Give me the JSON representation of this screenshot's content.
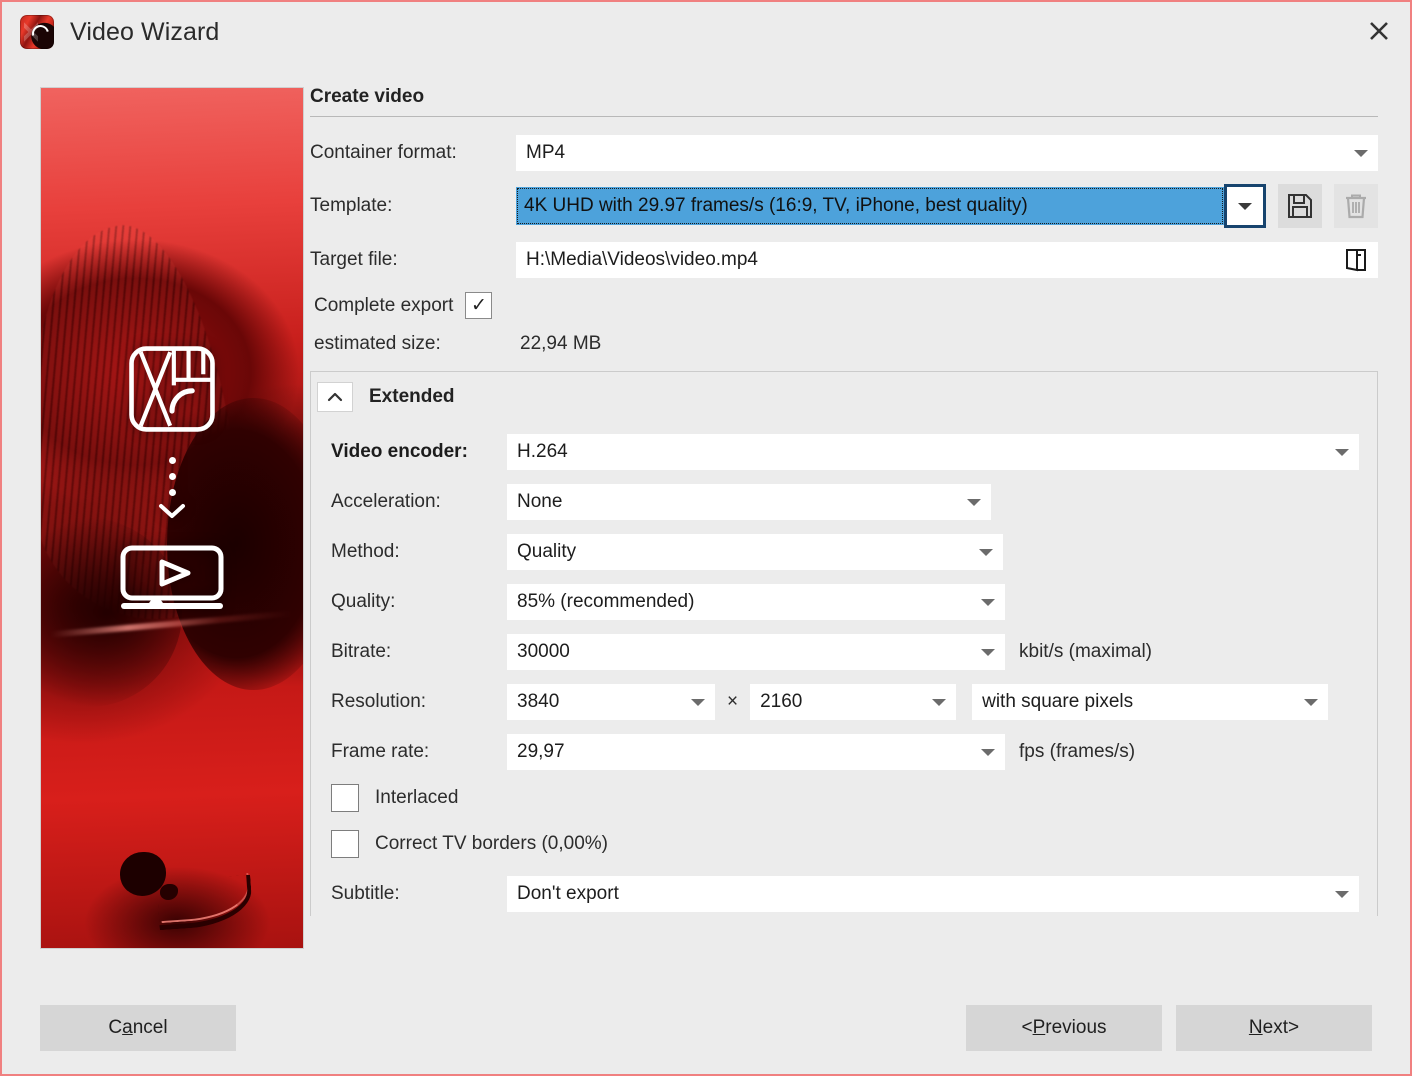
{
  "window": {
    "title": "Video Wizard",
    "app_icon": "video-wizard-app-icon",
    "close_icon": "close-icon",
    "border_color": "#f08080"
  },
  "preview": {
    "name": "video-preview-thumbnail",
    "logo_icon": "video-wizard-logo-icon",
    "dots_icon": "vertical-dots-icon",
    "chevron_icon": "chevron-down-icon",
    "player_icon": "video-player-icon"
  },
  "main": {
    "heading": "Create video",
    "fields": {
      "container_format": {
        "label": "Container format:",
        "value": "MP4"
      },
      "template": {
        "label": "Template:",
        "value": "4K UHD with 29.97 frames/s (16:9, TV, iPhone, best quality)",
        "selected": true,
        "highlight_color": "#4da2db",
        "focus_border_color": "#17446e",
        "save_icon": "save-floppy-icon",
        "delete_icon": "delete-trash-icon"
      },
      "target_file": {
        "label": "Target file:",
        "value": "H:\\Media\\Videos\\video.mp4",
        "browse_icon": "open-folder-icon"
      },
      "complete_export": {
        "label": "Complete export",
        "checked": true,
        "check_glyph": "✓"
      },
      "estimated_size": {
        "label": "estimated size:",
        "value": "22,94 MB"
      }
    }
  },
  "extended": {
    "title": "Extended",
    "collapse_icon": "chevron-up-icon",
    "expanded": true,
    "rows": {
      "video_encoder": {
        "label": "Video encoder:",
        "value": "H.264"
      },
      "acceleration": {
        "label": "Acceleration:",
        "value": "None"
      },
      "method": {
        "label": "Method:",
        "value": "Quality"
      },
      "quality": {
        "label": "Quality:",
        "value": "85% (recommended)"
      },
      "bitrate": {
        "label": "Bitrate:",
        "value": "30000",
        "unit": "kbit/s (maximal)"
      },
      "resolution": {
        "label": "Resolution:",
        "width": "3840",
        "separator": "×",
        "height": "2160",
        "pixel_mode": "with square pixels"
      },
      "frame_rate": {
        "label": "Frame rate:",
        "value": "29,97",
        "unit": "fps (frames/s)"
      },
      "interlaced": {
        "label": "Interlaced",
        "checked": false
      },
      "correct_tv_borders": {
        "label": "Correct TV borders (0,00%)",
        "checked": false
      },
      "subtitle": {
        "label": "Subtitle:",
        "value": "Don't export"
      }
    }
  },
  "footer": {
    "cancel": {
      "pre": "C",
      "mnemonic": "a",
      "post": "ncel",
      "label": "Cancel"
    },
    "previous": {
      "prefix": "< ",
      "pre": "",
      "mnemonic": "P",
      "post": "revious",
      "label": "< Previous"
    },
    "next": {
      "pre": "",
      "mnemonic": "N",
      "post": "ext",
      "suffix": " >",
      "label": "Next >"
    }
  }
}
